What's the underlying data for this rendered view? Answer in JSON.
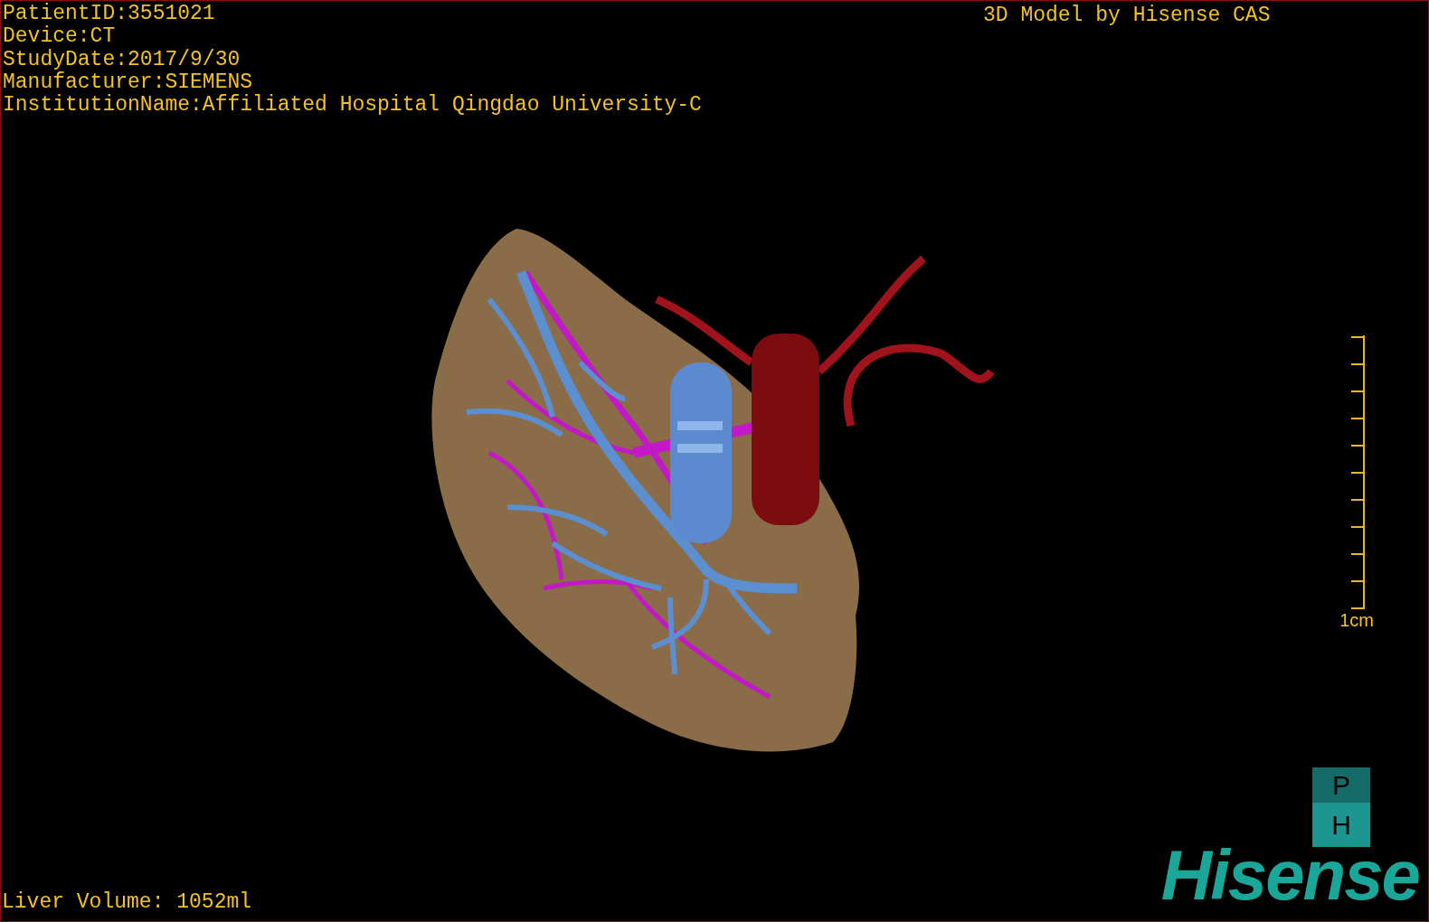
{
  "patient_info": [
    "PatientID:3551021",
    "Device:CT",
    "StudyDate:2017/9/30",
    "Manufacturer:SIEMENS",
    "InstitutionName:Affiliated Hospital Qingdao University-C"
  ],
  "model_credit": "3D Model by Hisense CAS",
  "scale_bar": {
    "label": "1cm"
  },
  "orientation_cube": {
    "top_face": "P",
    "front_face": "H"
  },
  "logo": "Hisense",
  "liver_volume": "Liver Volume: 1052ml"
}
